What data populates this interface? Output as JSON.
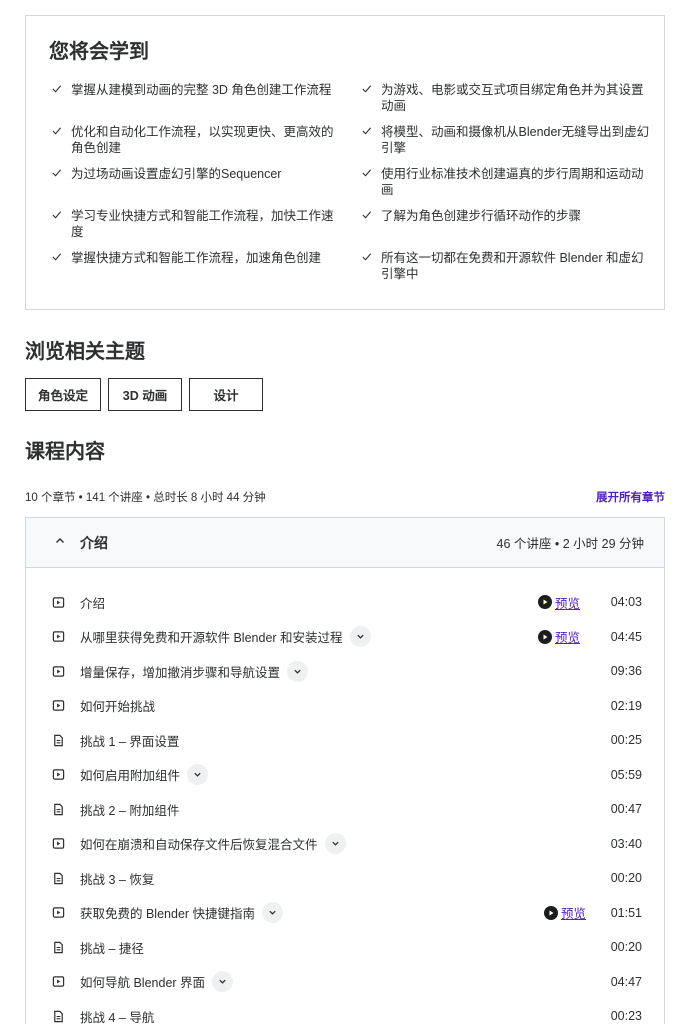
{
  "learn": {
    "title": "您将会学到",
    "items": [
      "掌握从建模到动画的完整 3D 角色创建工作流程",
      "为游戏、电影或交互式项目绑定角色并为其设置动画",
      "优化和自动化工作流程，以实现更快、更高效的角色创建",
      "将模型、动画和摄像机从Blender无缝导出到虚幻引擎",
      "为过场动画设置虚幻引擎的Sequencer",
      "使用行业标准技术创建逼真的步行周期和运动动画",
      "学习专业快捷方式和智能工作流程，加快工作速度",
      "了解为角色创建步行循环动作的步骤",
      "掌握快捷方式和智能工作流程，加速角色创建",
      "所有这一切都在免费和开源软件 Blender 和虚幻引擎中"
    ]
  },
  "topics": {
    "title": "浏览相关主题",
    "items": [
      "角色设定",
      "3D 动画",
      "设计"
    ]
  },
  "content": {
    "title": "课程内容",
    "summary": "10 个章节 • 141 个讲座 • 总时长 8 小时 44 分钟",
    "expand_all": "展开所有章节",
    "section": {
      "name": "介绍",
      "meta": "46 个讲座 • 2 小时 29 分钟"
    },
    "preview_label": "预览",
    "lectures": [
      {
        "title": "介绍",
        "type": "video",
        "dropdown": false,
        "preview": true,
        "duration": "04:03"
      },
      {
        "title": "从哪里获得免费和开源软件 Blender 和安装过程",
        "type": "video",
        "dropdown": true,
        "preview": true,
        "duration": "04:45"
      },
      {
        "title": "增量保存，增加撤消步骤和导航设置",
        "type": "video",
        "dropdown": true,
        "preview": false,
        "duration": "09:36"
      },
      {
        "title": "如何开始挑战",
        "type": "video",
        "dropdown": false,
        "preview": false,
        "duration": "02:19"
      },
      {
        "title": "挑战 1 – 界面设置",
        "type": "doc",
        "dropdown": false,
        "preview": false,
        "duration": "00:25"
      },
      {
        "title": "如何启用附加组件",
        "type": "video",
        "dropdown": true,
        "preview": false,
        "duration": "05:59"
      },
      {
        "title": "挑战 2 – 附加组件",
        "type": "doc",
        "dropdown": false,
        "preview": false,
        "duration": "00:47"
      },
      {
        "title": "如何在崩溃和自动保存文件后恢复混合文件",
        "type": "video",
        "dropdown": true,
        "preview": false,
        "duration": "03:40"
      },
      {
        "title": "挑战 3 – 恢复",
        "type": "doc",
        "dropdown": false,
        "preview": false,
        "duration": "00:20"
      },
      {
        "title": "获取免费的 Blender 快捷键指南",
        "type": "video",
        "dropdown": true,
        "preview": true,
        "duration": "01:51"
      },
      {
        "title": "挑战 – 捷径",
        "type": "doc",
        "dropdown": false,
        "preview": false,
        "duration": "00:20"
      },
      {
        "title": "如何导航 Blender 界面",
        "type": "video",
        "dropdown": true,
        "preview": false,
        "duration": "04:47"
      },
      {
        "title": "挑战 4 – 导航",
        "type": "doc",
        "dropdown": false,
        "preview": false,
        "duration": "00:23"
      }
    ]
  }
}
